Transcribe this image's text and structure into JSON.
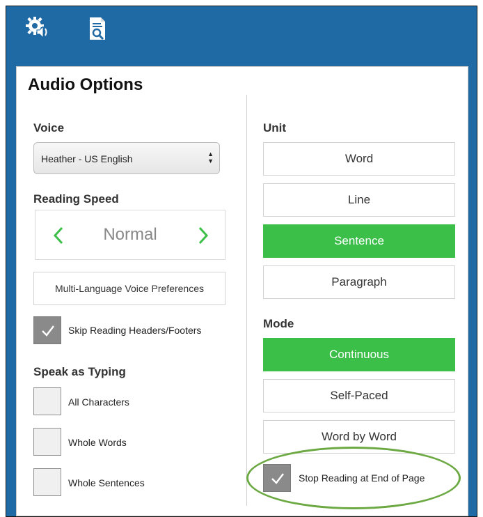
{
  "toolbar": {
    "icons": [
      "audio-settings-icon",
      "document-search-icon"
    ]
  },
  "panel": {
    "title": "Audio Options"
  },
  "left": {
    "voice": {
      "label": "Voice",
      "selected": "Heather - US English"
    },
    "reading_speed": {
      "label": "Reading Speed",
      "value": "Normal"
    },
    "multi_language_button": "Multi-Language Voice Preferences",
    "skip_headers": {
      "label": "Skip Reading Headers/Footers",
      "checked": true
    },
    "speak_as_typing": {
      "label": "Speak as Typing",
      "options": [
        {
          "label": "All Characters",
          "checked": false
        },
        {
          "label": "Whole Words",
          "checked": false
        },
        {
          "label": "Whole Sentences",
          "checked": false
        }
      ]
    }
  },
  "right": {
    "unit": {
      "label": "Unit",
      "options": [
        "Word",
        "Line",
        "Sentence",
        "Paragraph"
      ],
      "selected": "Sentence"
    },
    "mode": {
      "label": "Mode",
      "options": [
        "Continuous",
        "Self-Paced",
        "Word by Word"
      ],
      "selected": "Continuous"
    },
    "stop_at_end": {
      "label": "Stop Reading at End of Page",
      "checked": true
    }
  },
  "colors": {
    "header_blue": "#1f6aa5",
    "selected_green": "#3bbf49",
    "chevron_green": "#3bbf49",
    "highlight_oval": "#6ca943",
    "checkbox_checked": "#8a8a8a"
  }
}
